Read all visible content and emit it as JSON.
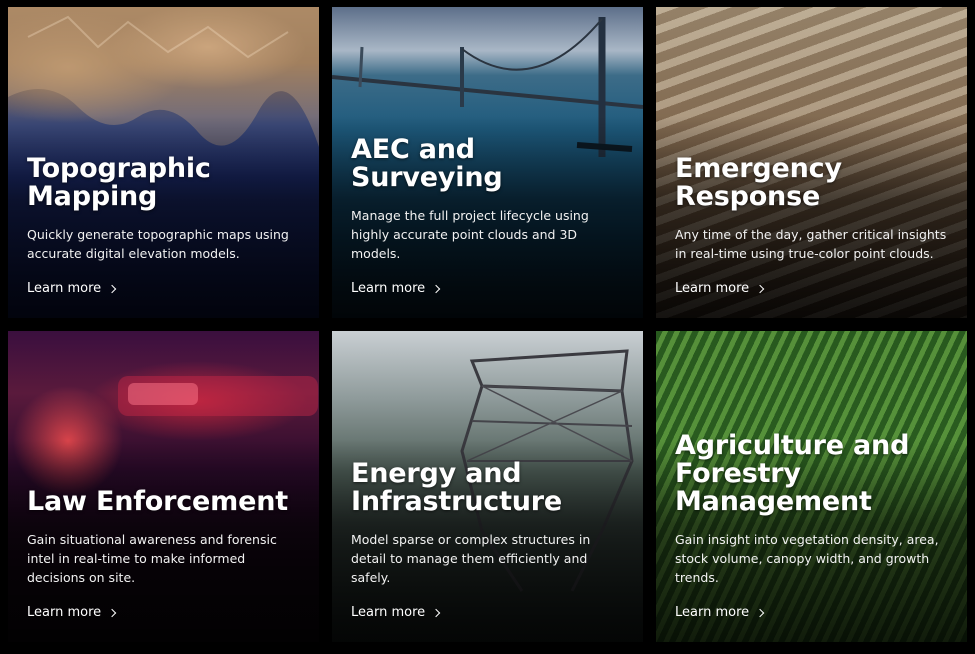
{
  "cards": [
    {
      "title": "Topographic Mapping",
      "description": "Quickly generate topographic maps using accurate digital elevation models.",
      "link": "Learn more",
      "icon": "chevron-right-icon"
    },
    {
      "title": "AEC and Surveying",
      "description": "Manage the full project lifecycle using highly accurate point clouds and 3D models.",
      "link": "Learn more",
      "icon": "chevron-right-icon"
    },
    {
      "title": "Emergency Response",
      "description": "Any time of the day, gather critical insights in real-time using true-color point clouds.",
      "link": "Learn more",
      "icon": "chevron-right-icon"
    },
    {
      "title": "Law Enforcement",
      "description": "Gain situational awareness and forensic intel in real-time to make informed decisions on site.",
      "link": "Learn more",
      "icon": "chevron-right-icon"
    },
    {
      "title": "Energy and Infrastructure",
      "description": "Model sparse or complex structures in detail to manage them efficiently and safely.",
      "link": "Learn more",
      "icon": "chevron-right-icon"
    },
    {
      "title": "Agriculture and Forestry Management",
      "description": "Gain insight into vegetation density, area, stock volume, canopy width, and growth trends.",
      "link": "Learn more",
      "icon": "chevron-right-icon"
    }
  ],
  "colors": {
    "background": "#000000",
    "text": "#ffffff"
  }
}
